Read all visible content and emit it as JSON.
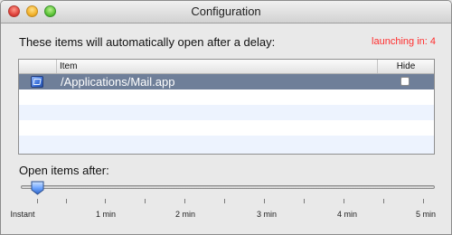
{
  "window": {
    "title": "Configuration"
  },
  "intro": "These items will automatically open after a delay:",
  "launching": "launching in: 4",
  "table": {
    "columns": [
      "",
      "Item",
      "Hide"
    ],
    "rows": [
      {
        "icon": "mail-app-icon",
        "item": "/Applications/Mail.app",
        "hide": false,
        "selected": true
      }
    ]
  },
  "open_after_label": "Open items after:",
  "slider": {
    "ticks": [
      "Instant",
      "1 min",
      "2 min",
      "3 min",
      "4 min",
      "5 min"
    ],
    "value_label": "Instant",
    "value_fraction": 0.02
  },
  "colors": {
    "launching_text": "#ff2d2d",
    "selected_row": "#6f7f99",
    "alt_row": "#edf3fe"
  }
}
